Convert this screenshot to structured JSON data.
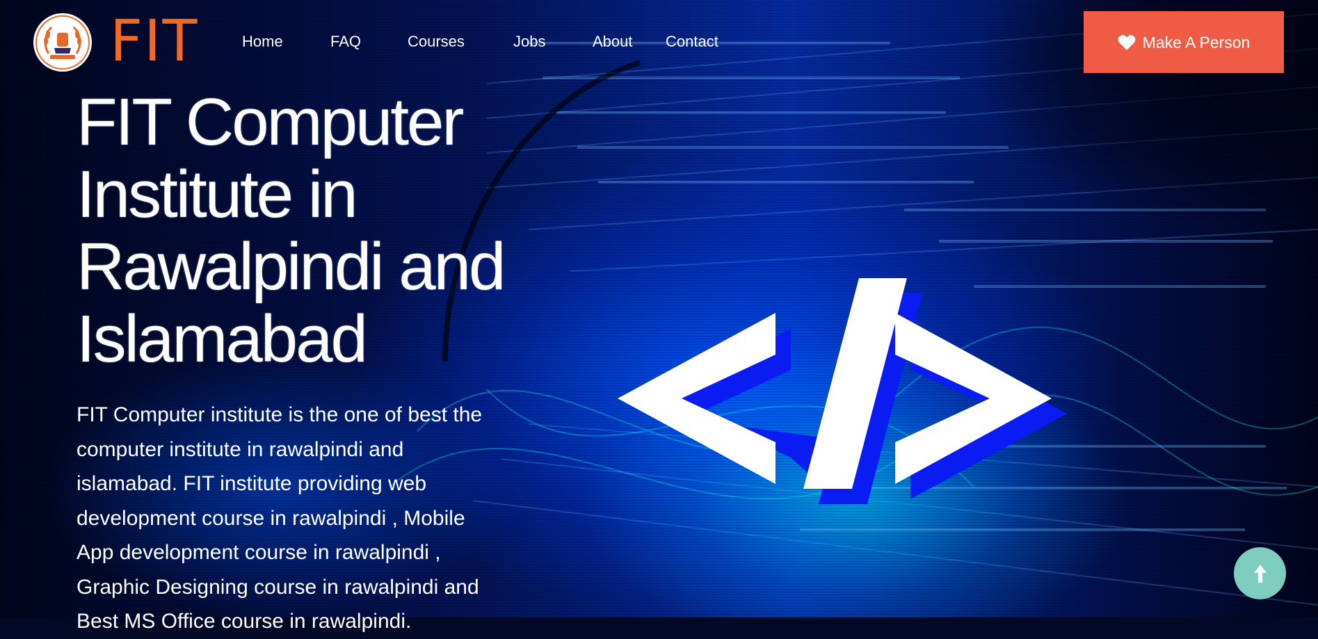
{
  "brand": {
    "name": "FIT",
    "logo_icon": "institute-emblem-icon",
    "color": "#f26a21"
  },
  "nav": {
    "items": [
      {
        "label": "Home"
      },
      {
        "label": "FAQ"
      },
      {
        "label": "Courses"
      },
      {
        "label": "Jobs"
      },
      {
        "label": "About"
      },
      {
        "label": "Contact"
      }
    ]
  },
  "cta": {
    "label": "Make A Person",
    "icon": "heart-icon",
    "color": "#ef5b45"
  },
  "hero": {
    "title_lines": [
      "FIT Computer",
      "Institute in",
      "Rawalpindi and",
      "Islamabad"
    ],
    "description_lines": [
      "FIT Computer institute is the one of best the",
      "computer institute in rawalpindi and",
      "islamabad. FIT institute providing web",
      "development course in rawalpindi , Mobile",
      "App development course in rawalpindi ,",
      "Graphic Designing course in rawalpindi and",
      "Best MS Office course in rawalpindi."
    ],
    "symbol_icon": "code-brackets-icon"
  },
  "scroll_top": {
    "icon": "arrow-up-icon",
    "color": "#7fcdbf"
  }
}
